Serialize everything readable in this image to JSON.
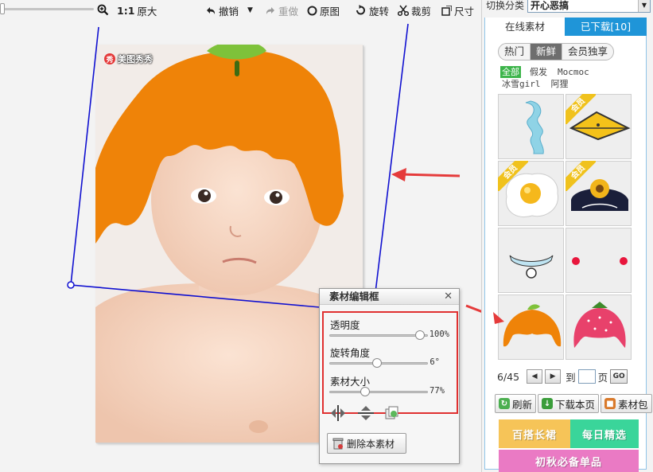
{
  "toolbar": {
    "zoom_icon": "zoom-in-icon",
    "actual_size_ratio": "1:1",
    "actual_size_label": "原大",
    "undo": "撤销",
    "redo": "重做",
    "original": "原图",
    "rotate": "旋转",
    "crop": "裁剪",
    "resize": "尺寸"
  },
  "canvas": {
    "watermark": "美图秀秀",
    "watermark_logo": "秀"
  },
  "editor": {
    "title": "素材编辑框",
    "close": "✕",
    "sliders": [
      {
        "label": "透明度",
        "value": "100%",
        "level": 1.0
      },
      {
        "label": "旋转角度",
        "value": "6°",
        "level": 0.5
      },
      {
        "label": "素材大小",
        "value": "77%",
        "level": 0.38
      }
    ],
    "delete_button": "删除本素材"
  },
  "right_panel": {
    "category_label": "切换分类",
    "category_value": "开心恶搞",
    "tabs": [
      {
        "label": "在线素材",
        "active": true
      },
      {
        "label": "已下载[10]",
        "active": false
      }
    ],
    "subtabs": [
      {
        "label": "热门",
        "active": false
      },
      {
        "label": "新鲜",
        "active": true
      },
      {
        "label": "会员独享",
        "active": false
      }
    ],
    "filters": [
      {
        "label": "全部",
        "active": true
      },
      {
        "label": "假发",
        "active": false
      },
      {
        "label": "Mocmoc",
        "active": false
      },
      {
        "label": "冰雪girl",
        "active": false
      },
      {
        "label": "阿狸",
        "active": false
      }
    ],
    "vip_badge": "会员",
    "materials": [
      {
        "name": "blue-wave-wig",
        "vip": false
      },
      {
        "name": "duck-beak",
        "vip": true
      },
      {
        "name": "fried-egg",
        "vip": true
      },
      {
        "name": "flower-hat",
        "vip": true
      },
      {
        "name": "bell-collar",
        "vip": false
      },
      {
        "name": "red-cheeks",
        "vip": false
      },
      {
        "name": "orange-wig",
        "vip": false
      },
      {
        "name": "strawberry-hat",
        "vip": false
      }
    ],
    "pager": {
      "current": "6/45",
      "prev": "◀",
      "next": "▶",
      "to_label": "到",
      "page_label": "页",
      "go": "GO"
    },
    "actions": {
      "refresh": "刷新",
      "download_page": "下载本页",
      "material_pack": "素材包"
    },
    "banners": [
      "百搭长裙",
      "每日精选",
      "初秋必备单品"
    ]
  },
  "colors": {
    "accent_blue": "#1f95d8",
    "highlight_red": "#e03030",
    "active_green": "#3cb44a",
    "wig_orange": "#ef8308"
  }
}
